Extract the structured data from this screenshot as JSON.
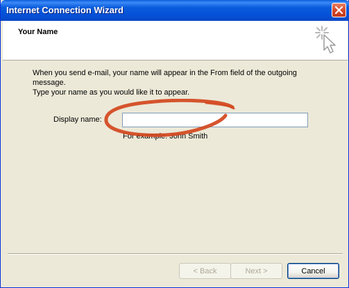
{
  "window": {
    "title": "Internet Connection Wizard"
  },
  "header": {
    "title": "Your Name",
    "icon": "wizard-sparkle-cursor-icon"
  },
  "content": {
    "intro_line1": "When you send e-mail, your name will appear in the From field of the outgoing message.",
    "intro_line2": "Type your name as you would like it to appear.",
    "display_name_label": "Display name:",
    "display_name_value": "",
    "example_text": "For example: John Smith"
  },
  "annotation": {
    "shape": "hand-drawn ellipse",
    "color": "#d2461e"
  },
  "buttons": {
    "back_label": "< Back",
    "next_label": "Next >",
    "cancel_label": "Cancel"
  },
  "colors": {
    "titlebar": "#0a5ddc",
    "dialog_bg": "#ece9d8",
    "header_bg": "#ffffff"
  }
}
